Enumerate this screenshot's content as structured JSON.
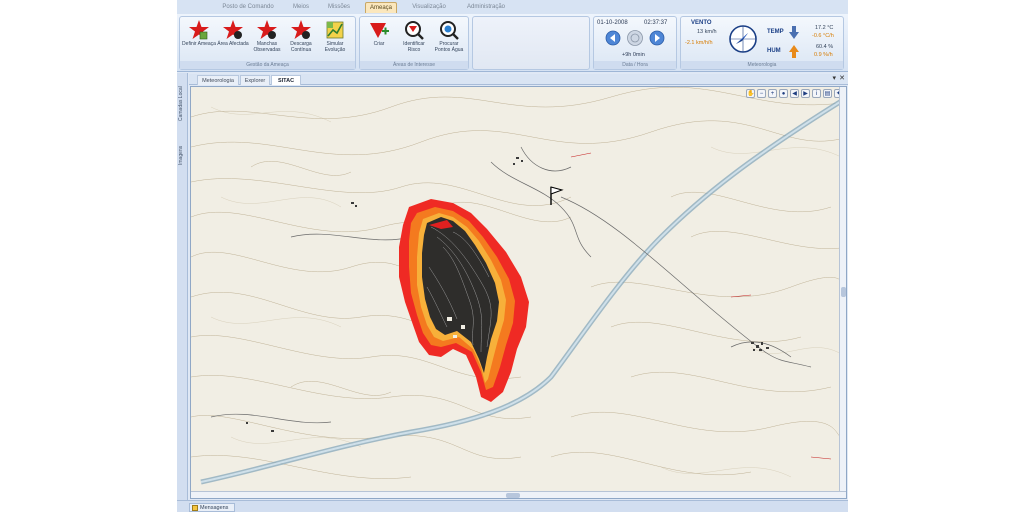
{
  "ribbon_tabs": [
    "Posto de Comando",
    "Meios",
    "Missões",
    "Ameaça",
    "Visualização",
    "Administração"
  ],
  "active_tab": "Ameaça",
  "threat_management": {
    "group_label": "Gestão da Ameaça",
    "buttons": [
      {
        "label": "Definir Ameaça",
        "icon": "star-define-icon"
      },
      {
        "label": "Área Afectada",
        "icon": "star-area-icon"
      },
      {
        "label": "Manchas Observadas",
        "icon": "star-spots-icon"
      },
      {
        "label": "Descarga Contínua",
        "icon": "star-discharge-icon"
      },
      {
        "label": "Simular Evolução",
        "icon": "simulate-chart-icon"
      }
    ]
  },
  "areas_of_interest": {
    "group_label": "Áreas de Interesse",
    "buttons": [
      {
        "label": "Criar",
        "icon": "create-area-icon"
      },
      {
        "label": "Identificar Risco",
        "icon": "identify-risk-icon"
      },
      {
        "label": "Procurar Pontos Água",
        "icon": "search-water-icon"
      }
    ]
  },
  "datetime": {
    "group_label": "Data / Hora",
    "date": "01-10-2008",
    "time": "02:37:37",
    "offset": "+9h 0min"
  },
  "weather": {
    "group_label": "Meteorologia",
    "wind_label": "VENTO",
    "wind_speed": "13 km/h",
    "wind_change": "-2.1 km/h/h",
    "temp_label": "TEMP",
    "temp_value": "17.2 °C",
    "temp_change": "-0.6 °C/h",
    "hum_label": "HUM",
    "hum_value": "60.4 %",
    "hum_change": "0.9 %/h"
  },
  "side_tabs": [
    "Camadas Local",
    "Imagens"
  ],
  "doc_tabs": [
    "Meteorologia",
    "Explorer",
    "SITAC"
  ],
  "active_doc_tab": "SITAC",
  "map": {
    "toolbar": [
      "pan-icon",
      "zoom-out-icon",
      "zoom-in-icon",
      "globe-icon",
      "back-icon",
      "forward-icon",
      "info-icon",
      "print-icon",
      "settings-icon"
    ]
  },
  "status": {
    "messages_tab": "Mensagens"
  }
}
